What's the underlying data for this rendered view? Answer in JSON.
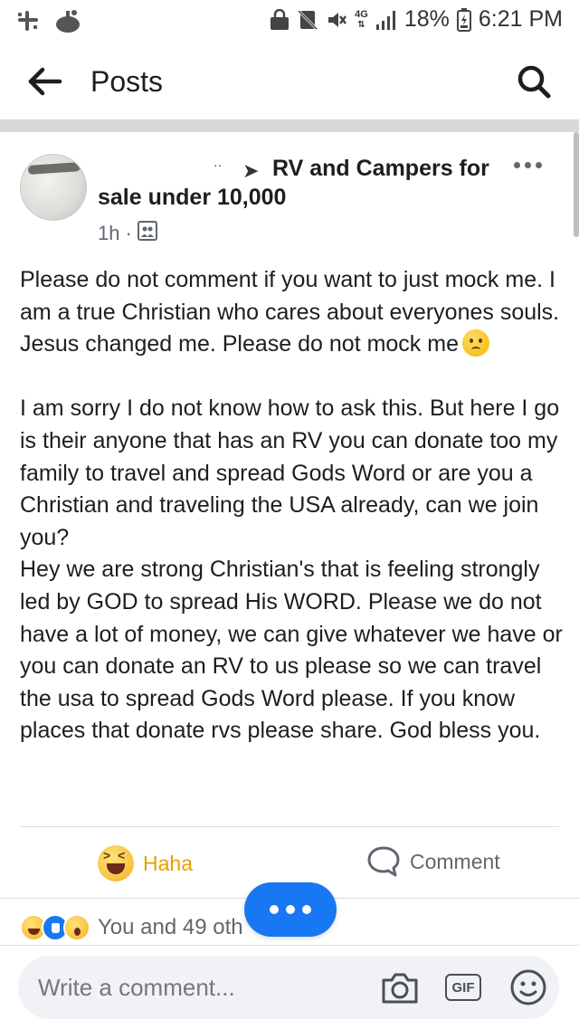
{
  "status_bar": {
    "battery_percent": "18%",
    "time": "6:21 PM",
    "network": "4G"
  },
  "header": {
    "title": "Posts"
  },
  "post": {
    "group_name_line1": "RV and Campers for",
    "group_name_line2": "sale under 10,000",
    "author_fragment": "··",
    "timestamp": "1h",
    "body_paragraph_1": "Please do not comment if you want to just mock me. I am a true Christian who cares about everyones souls. Jesus changed me. Please do not mock me",
    "body_paragraph_2": "I am sorry I do not know how to ask this. But here I go is their anyone that has an RV you can donate too my family to travel and spread Gods Word or are you a Christian and traveling the USA already, can we join you?\nHey we are strong Christian's that is feeling strongly led by GOD to spread His WORD. Please we do not have a lot of money, we can give whatever we have or you can donate an RV to us please so we can travel the usa to spread Gods Word please. If you know places that donate rvs please share. God bless you."
  },
  "actions": {
    "reaction_label": "Haha",
    "comment_label": "Comment",
    "reaction_color": "#e6a000"
  },
  "reactions_summary": {
    "text": "You and 49 oth",
    "icons": [
      "haha-icon",
      "like-icon",
      "wow-icon"
    ]
  },
  "composer": {
    "placeholder": "Write a comment...",
    "gif_label": "GIF"
  },
  "colors": {
    "brand_blue": "#1877f2",
    "secondary_text": "#606770"
  }
}
